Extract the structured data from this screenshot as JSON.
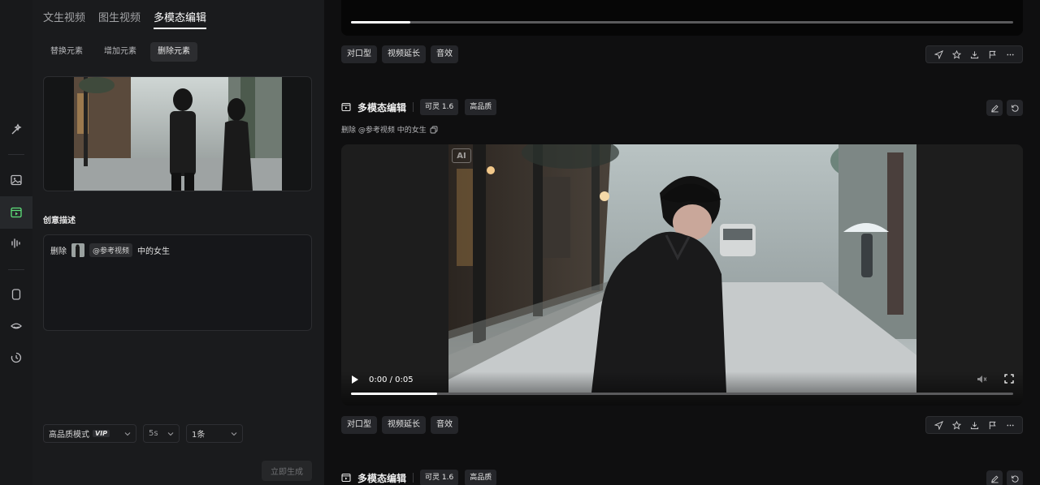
{
  "left_panel": {
    "tabs": [
      {
        "label": "文生视频",
        "active": false
      },
      {
        "label": "图生视频",
        "active": false
      },
      {
        "label": "多模态编辑",
        "active": true
      }
    ],
    "subtabs": [
      {
        "label": "替换元素",
        "active": false
      },
      {
        "label": "增加元素",
        "active": false
      },
      {
        "label": "删除元素",
        "active": true
      }
    ],
    "section_title": "创意描述",
    "prompt": {
      "prefix": "删除",
      "ref_tag": "@参考视频",
      "suffix": "中的女生"
    },
    "selects": {
      "quality": {
        "value": "高品质模式",
        "badge": "VIP"
      },
      "duration": {
        "value": "5s"
      },
      "count": {
        "value": "1条"
      }
    },
    "generate_label": "立即生成"
  },
  "feed": {
    "actions": [
      "对口型",
      "视频延长",
      "音效"
    ],
    "card": {
      "title": "多模态编辑",
      "model": "可灵 1.6",
      "quality": "高品质",
      "description": "删除 @参考视频 中的女生"
    },
    "video": {
      "ai_label": "AI",
      "time": "0:00 / 0:05",
      "progress": 0.13
    },
    "top_video_progress": 0.09,
    "card2": {
      "title": "多模态编辑",
      "model": "可灵 1.6",
      "quality": "高品质"
    }
  },
  "colors": {
    "panel_bg": "#1a1b1d",
    "feed_bg": "#0f0f10",
    "rail_bg": "#18191b",
    "accent": "#ffffff"
  }
}
